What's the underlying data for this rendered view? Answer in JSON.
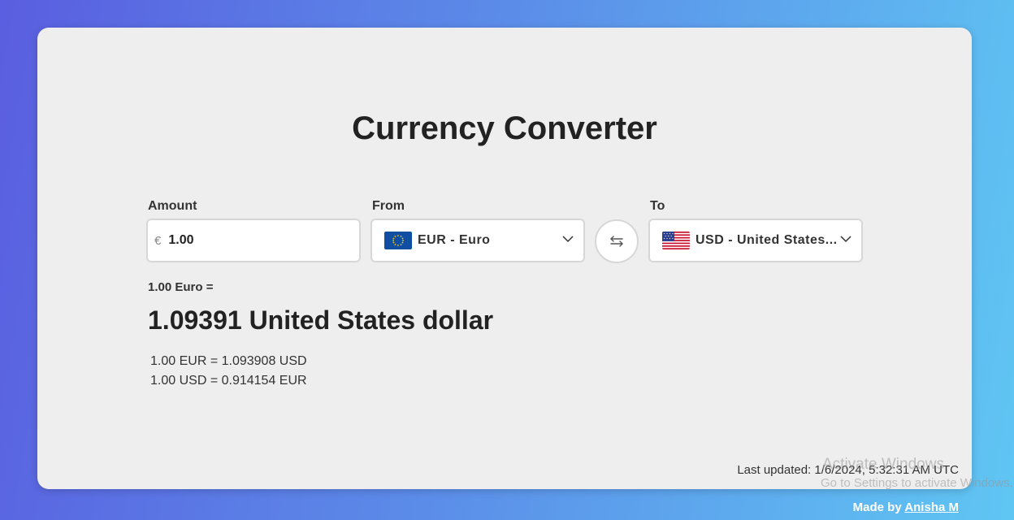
{
  "title": "Currency Converter",
  "amount": {
    "label": "Amount",
    "symbol": "€",
    "value": "1.00"
  },
  "from": {
    "label": "From",
    "selected": "EUR - Euro",
    "flag": "eu-flag-icon"
  },
  "to": {
    "label": "To",
    "selected": "USD - United States...",
    "flag": "us-flag-icon"
  },
  "swap_icon": "swap-arrows-icon",
  "result": {
    "equation_label": "1.00 Euro =",
    "converted": "1.09391 United States dollar",
    "rate_forward": "1.00 EUR = 1.093908 USD",
    "rate_reverse": "1.00 USD = 0.914154 EUR"
  },
  "last_updated": "Last updated: 1/6/2024, 5:32:31 AM UTC",
  "footer": {
    "prefix": "Made by",
    "author": "Anisha M"
  },
  "watermark": {
    "line1": "Activate Windows",
    "line2": "Go to Settings to activate Windows."
  },
  "colors": {
    "card": "#eeeeee",
    "gradient_start": "#5a5ee0",
    "gradient_end": "#5fc6f3",
    "eu_blue": "#0f4ea0",
    "eu_star": "#ffd21f"
  }
}
